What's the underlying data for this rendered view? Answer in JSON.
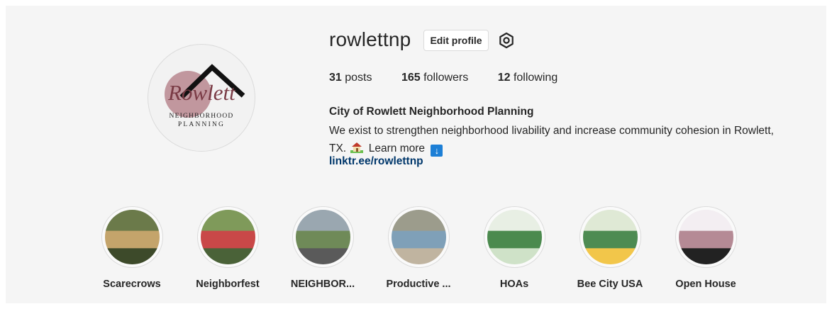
{
  "profile": {
    "username": "rowlettnp",
    "edit_button_label": "Edit profile",
    "settings_icon": "gear-icon",
    "avatar_logo": {
      "script": "Rowlett",
      "line1": "NEIGHBORHOOD",
      "line2": "PLANNING"
    }
  },
  "stats": [
    {
      "count": "31",
      "label": "posts"
    },
    {
      "count": "165",
      "label": "followers"
    },
    {
      "count": "12",
      "label": "following"
    }
  ],
  "bio": {
    "name": "City of Rowlett Neighborhood Planning",
    "text_part1": "We exist to strengthen neighborhood livability and increase community cohesion in Rowlett, TX.",
    "text_part2": "Learn more",
    "house_emoji": "house-with-garden-emoji",
    "arrow_emoji": "down-arrow-emoji",
    "link": "linktr.ee/rowlettnp"
  },
  "highlights": [
    {
      "label": "Scarecrows",
      "thumb_colors": [
        "#6b7a4a",
        "#c4a46b",
        "#3d4a2a"
      ]
    },
    {
      "label": "Neighborfest",
      "thumb_colors": [
        "#7f9a5a",
        "#c94848",
        "#4a6238"
      ]
    },
    {
      "label": "NEIGHBOR...",
      "thumb_colors": [
        "#9aa7b0",
        "#6f8a58",
        "#5a5a5a"
      ]
    },
    {
      "label": "Productive ...",
      "thumb_colors": [
        "#9c9c8c",
        "#7fa0b8",
        "#c0b4a0"
      ]
    },
    {
      "label": "HOAs",
      "thumb_colors": [
        "#e8efe4",
        "#4b8a4e",
        "#cfe2c8"
      ]
    },
    {
      "label": "Bee City USA",
      "thumb_colors": [
        "#dfe9d5",
        "#4d8b52",
        "#f2c64a"
      ]
    },
    {
      "label": "Open House",
      "thumb_colors": [
        "#f3eef2",
        "#b58a95",
        "#222222"
      ]
    }
  ],
  "colors": {
    "link": "#00376b",
    "text": "#262626",
    "border": "#dbdbdb",
    "background": "#f5f5f5"
  }
}
